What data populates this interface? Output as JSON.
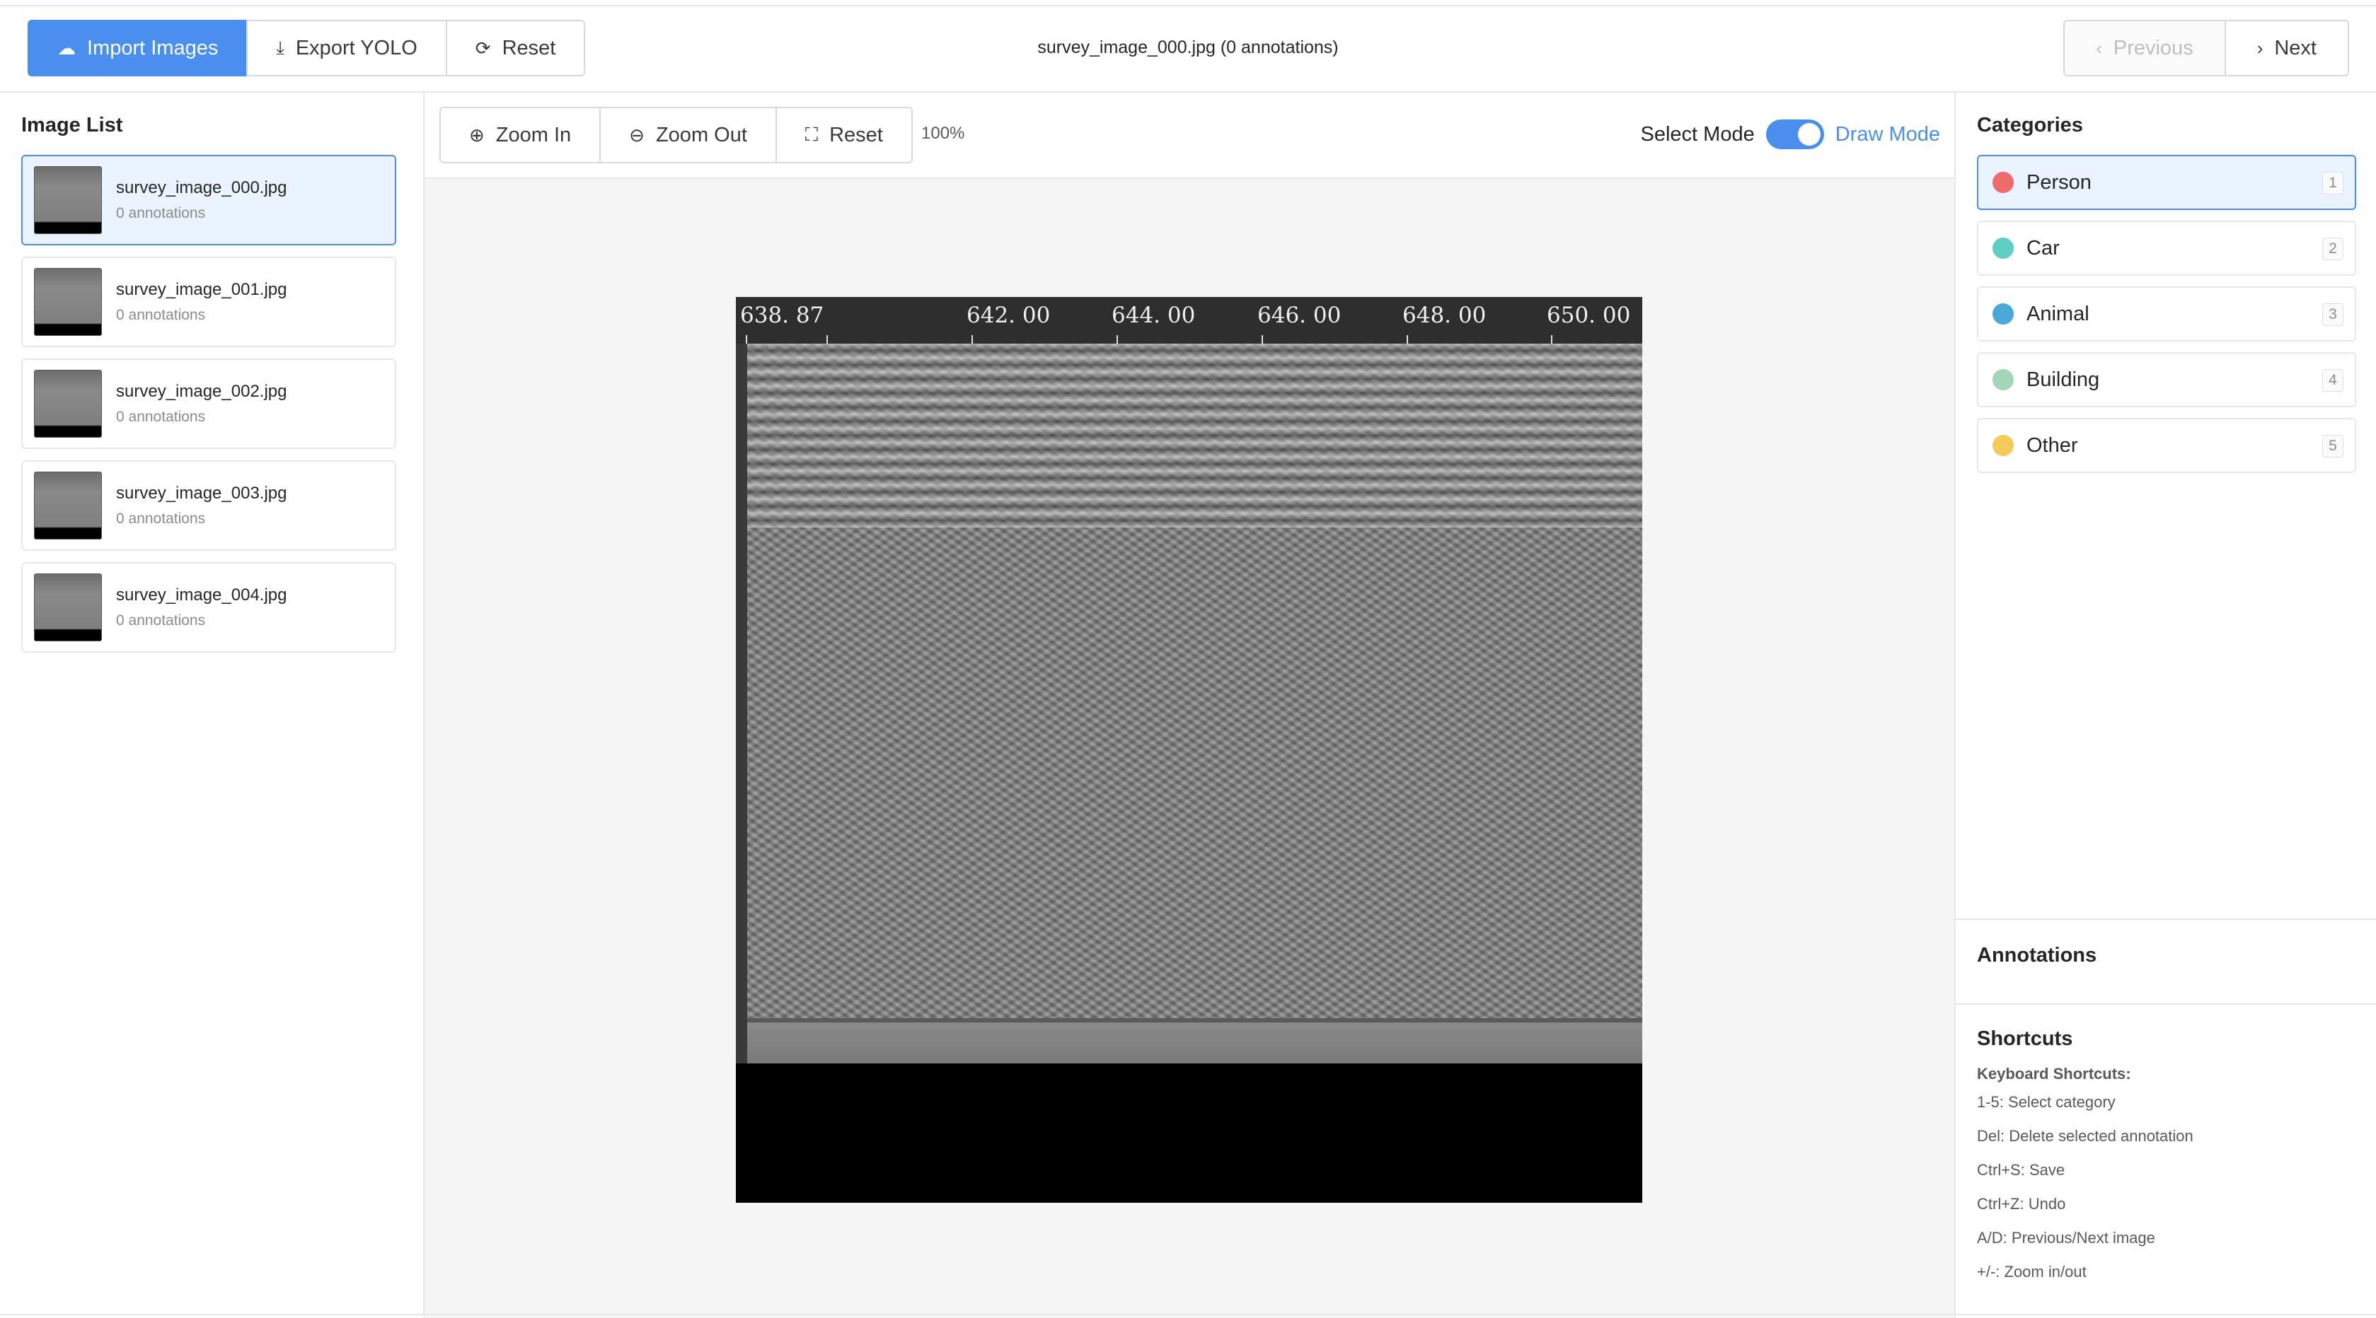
{
  "header": {
    "import_label": "Import Images",
    "export_label": "Export YOLO",
    "reset_label": "Reset",
    "title": "survey_image_000.jpg (0 annotations)",
    "previous_label": "Previous",
    "next_label": "Next"
  },
  "left": {
    "title": "Image List",
    "images": [
      {
        "name": "survey_image_000.jpg",
        "count": "0 annotations"
      },
      {
        "name": "survey_image_001.jpg",
        "count": "0 annotations"
      },
      {
        "name": "survey_image_002.jpg",
        "count": "0 annotations"
      },
      {
        "name": "survey_image_003.jpg",
        "count": "0 annotations"
      },
      {
        "name": "survey_image_004.jpg",
        "count": "0 annotations"
      }
    ]
  },
  "toolbar": {
    "zoom_in_label": "Zoom In",
    "zoom_out_label": "Zoom Out",
    "reset_label": "Reset",
    "zoom_level": "100%",
    "select_mode_label": "Select Mode",
    "draw_mode_label": "Draw Mode"
  },
  "canvas": {
    "scale_labels": [
      "638. 87",
      "642. 00",
      "644. 00",
      "646. 00",
      "648. 00",
      "650. 00"
    ]
  },
  "categories": {
    "title": "Categories",
    "items": [
      {
        "name": "Person",
        "key": "1",
        "color": "#ef6b6b"
      },
      {
        "name": "Car",
        "key": "2",
        "color": "#5fcfc6"
      },
      {
        "name": "Animal",
        "key": "3",
        "color": "#4aa8d6"
      },
      {
        "name": "Building",
        "key": "4",
        "color": "#a3d5b9"
      },
      {
        "name": "Other",
        "key": "5",
        "color": "#f5c95a"
      }
    ]
  },
  "annotations": {
    "title": "Annotations"
  },
  "shortcuts": {
    "title": "Shortcuts",
    "heading": "Keyboard Shortcuts:",
    "lines": [
      "1-5: Select category",
      "Del: Delete selected annotation",
      "Ctrl+S: Save",
      "Ctrl+Z: Undo",
      "A/D: Previous/Next image",
      "+/-: Zoom in/out"
    ]
  },
  "colors": {
    "accent": "#4a8ff0"
  }
}
